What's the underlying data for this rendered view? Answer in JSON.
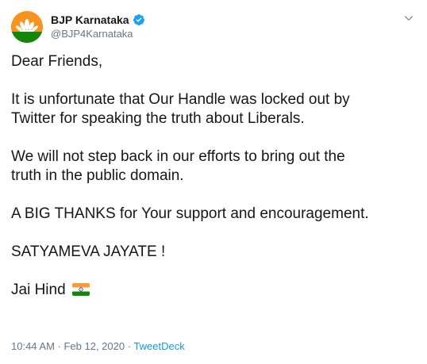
{
  "author": {
    "display_name": "BJP Karnataka",
    "handle": "@BJP4Karnataka",
    "verified_icon": "verified-badge-icon",
    "avatar_icon": "bjp-lotus-logo"
  },
  "tweet": {
    "greeting": "Dear Friends,",
    "para1": "It is unfortunate that Our Handle was locked out by\nTwitter for speaking the truth about Liberals.",
    "para2": "We will not step back in our efforts to bring out the\ntruth in the public domain.",
    "para3": "A BIG THANKS for Your support and encouragement.",
    "para4": "SATYAMEVA JAYATE !",
    "signoff": "Jai Hind",
    "flag_icon": "india-flag-icon"
  },
  "meta": {
    "timestamp": "10:44 AM · Feb 12, 2020",
    "separator": " · ",
    "source": "TweetDeck"
  },
  "colors": {
    "text": "#14171a",
    "secondary": "#657786",
    "link": "#1b95e0",
    "verified": "#1da1f2",
    "avatar_orange": "#f7931e",
    "avatar_green": "#138808"
  }
}
